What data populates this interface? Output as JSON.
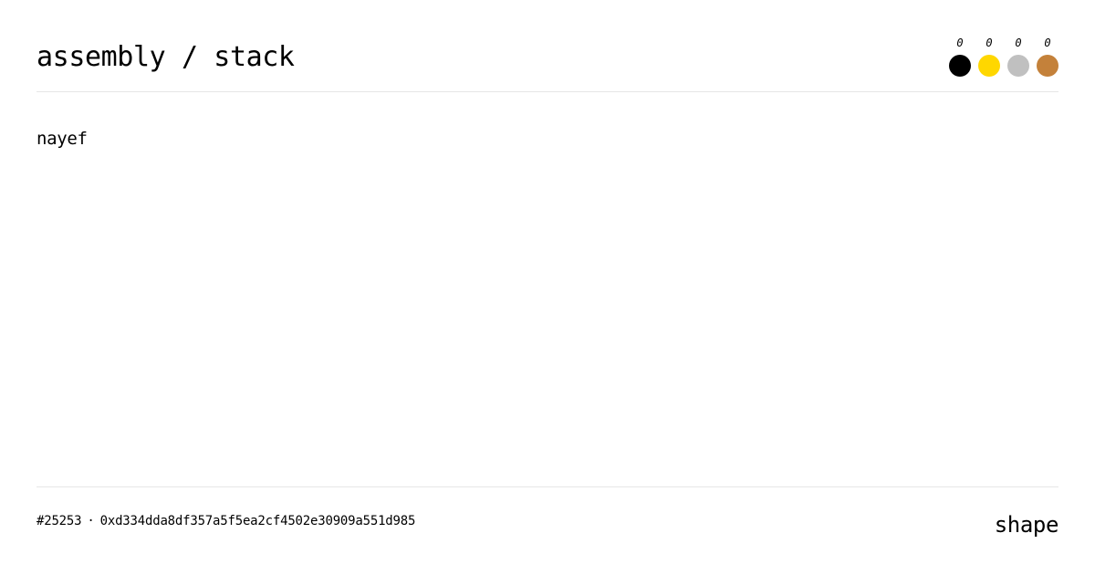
{
  "header": {
    "title": "assembly / stack",
    "dots": [
      {
        "count": "0",
        "color": "#000000",
        "icon": "black-circle-icon"
      },
      {
        "count": "0",
        "color": "#FFD700",
        "icon": "gold-circle-icon"
      },
      {
        "count": "0",
        "color": "#C0C0C0",
        "icon": "silver-circle-icon"
      },
      {
        "count": "0",
        "color": "#C4813A",
        "icon": "bronze-circle-icon"
      }
    ]
  },
  "author": "nayef",
  "footer": {
    "id": "#25253",
    "separator": "·",
    "hash": "0xd334dda8df357a5f5ea2cf4502e30909a551d985",
    "brand": "shape"
  }
}
